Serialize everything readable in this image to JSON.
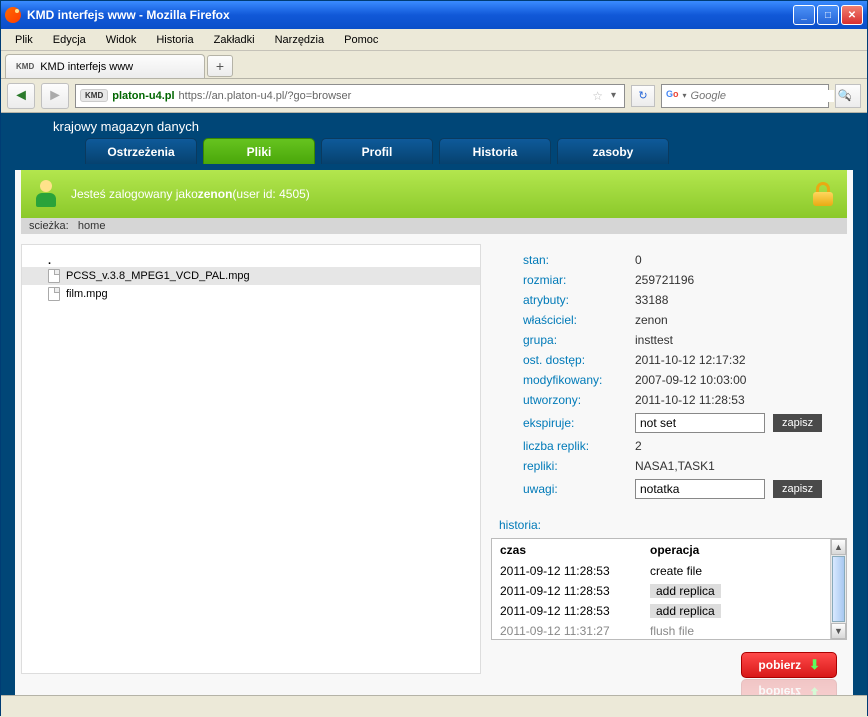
{
  "window": {
    "title": "KMD interfejs www - Mozilla Firefox"
  },
  "menu": {
    "items": [
      "Plik",
      "Edycja",
      "Widok",
      "Historia",
      "Zakładki",
      "Narzędzia",
      "Pomoc"
    ]
  },
  "browser_tab": {
    "favicon": "KMD",
    "title": "KMD interfejs www"
  },
  "url": {
    "badge": "KMD",
    "host": "platon-u4.pl",
    "rest": "https://an.platon-u4.pl/?go=browser"
  },
  "search": {
    "placeholder": "Google"
  },
  "brand": "krajowy magazyn danych",
  "tabs": {
    "items": [
      "Ostrzeżenia",
      "Pliki",
      "Profil",
      "Historia",
      "zasoby"
    ],
    "active_index": 1
  },
  "login": {
    "prefix": "Jesteś zalogowany jako ",
    "user": "zenon",
    "suffix": " (user id: 4505)"
  },
  "path": {
    "label": "scieżka:",
    "value": "home"
  },
  "files": [
    {
      "name": "PCSS_v.3.8_MPEG1_VCD_PAL.mpg",
      "selected": true
    },
    {
      "name": "film.mpg",
      "selected": false
    }
  ],
  "details": {
    "stan": {
      "label": "stan:",
      "value": "0"
    },
    "rozmiar": {
      "label": "rozmiar:",
      "value": "259721196"
    },
    "atrybuty": {
      "label": "atrybuty:",
      "value": "33188"
    },
    "wlasciciel": {
      "label": "właściciel:",
      "value": "zenon"
    },
    "grupa": {
      "label": "grupa:",
      "value": "insttest"
    },
    "ost_dostep": {
      "label": "ost. dostęp:",
      "value": "2011-10-12 12:17:32"
    },
    "modyfikowany": {
      "label": "modyfikowany:",
      "value": "2007-09-12 10:03:00"
    },
    "utworzony": {
      "label": "utworzony:",
      "value": "2011-10-12 11:28:53"
    },
    "ekspiruje": {
      "label": "ekspiruje:",
      "value": "not set",
      "button": "zapisz"
    },
    "liczba_replik": {
      "label": "liczba replik:",
      "value": "2"
    },
    "repliki": {
      "label": "repliki:",
      "value": "NASA1,TASK1"
    },
    "uwagi": {
      "label": "uwagi:",
      "value": "notatka",
      "button": "zapisz"
    }
  },
  "history": {
    "label": "historia:",
    "columns": {
      "time": "czas",
      "op": "operacja"
    },
    "rows": [
      {
        "time": "2011-09-12 11:28:53",
        "op": "create file",
        "newop": false
      },
      {
        "time": "2011-09-12 11:28:53",
        "op": "add replica",
        "newop": true
      },
      {
        "time": "2011-09-12 11:28:53",
        "op": "add replica",
        "newop": true
      },
      {
        "time": "2011-09-12 11:31:27",
        "op": "flush file",
        "newop": false,
        "cut": true
      }
    ]
  },
  "download": {
    "label": "pobierz"
  }
}
